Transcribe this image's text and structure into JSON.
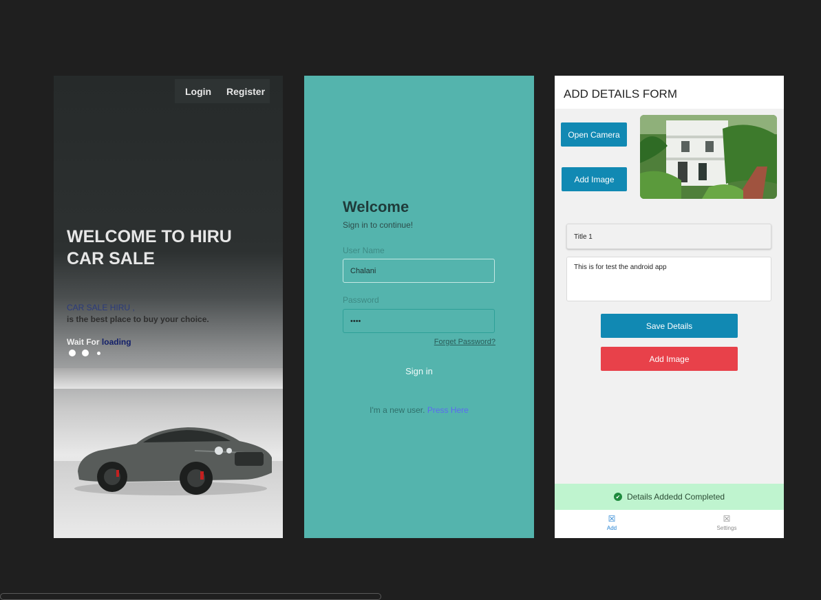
{
  "screen1": {
    "nav": {
      "login": "Login",
      "register": "Register"
    },
    "title": "WELCOME TO HIRU CAR SALE",
    "subtitle1": "CAR SALE HIRU ,",
    "subtitle2": "is the best place to buy your choice.",
    "wait_prefix": "Wait For",
    "wait_word": "loading"
  },
  "screen2": {
    "welcome": "Welcome",
    "sign_in_to": "Sign in to continue!",
    "username_label": "User Name",
    "username_value": "Chalani",
    "password_label": "Password",
    "password_value": "••••",
    "forget": "Forget Password?",
    "signin": "Sign in",
    "new_user_text": "I'm a new user.",
    "press_here": "Press Here"
  },
  "screen3": {
    "title": "ADD DETAILS FORM",
    "open_camera": "Open Camera",
    "add_image": "Add Image",
    "title_field": "Title 1",
    "description_field": "This is for test the android app",
    "save_details": "Save Details",
    "add_image_red": "Add Image",
    "toast": "Details Addedd Completed",
    "tabs": [
      {
        "label": "Add",
        "icon": "☒",
        "active": true
      },
      {
        "label": "Settings",
        "icon": "☒",
        "active": false
      }
    ]
  },
  "colors": {
    "screen2_bg": "#54b4ad",
    "primary_blue": "#1189b3",
    "danger_red": "#e8414a",
    "toast_green": "#bff4cf"
  }
}
